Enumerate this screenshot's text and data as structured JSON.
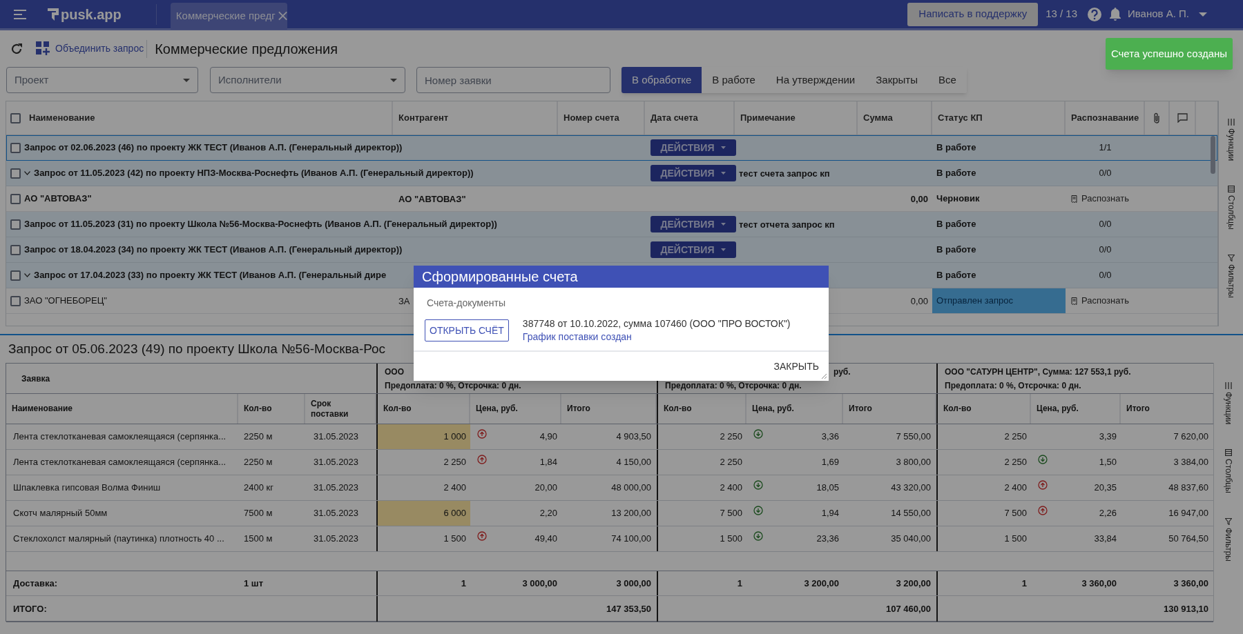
{
  "top_bar": {
    "app_name": "pusk.app",
    "tab": {
      "label": "Коммерческие предг"
    },
    "support_button": "Написать в поддержку",
    "counter": "13 / 13",
    "user": "Иванов А. П."
  },
  "toolbar": {
    "merge_link": "Объединить запрос",
    "title": "Коммерческие предложения"
  },
  "filters": [
    {
      "kind": "select",
      "placeholder": "Проект"
    },
    {
      "kind": "select",
      "placeholder": "Исполнители"
    },
    {
      "kind": "input",
      "placeholder": "Номер заявки"
    }
  ],
  "status_tabs": [
    {
      "label": "В обработке",
      "selected": true
    },
    {
      "label": "В работе",
      "selected": false
    },
    {
      "label": "На утверждении",
      "selected": false
    },
    {
      "label": "Закрыты",
      "selected": false
    },
    {
      "label": "Все",
      "selected": false
    }
  ],
  "requests_table": {
    "header_checked": false,
    "columns": [
      "Наименование",
      "Контрагент",
      "Номер счета",
      "Дата счета",
      "Примечание",
      "Сумма",
      "Статус КП",
      "Распознавание"
    ],
    "rows": [
      {
        "kind": "request",
        "checked": false,
        "selected": true,
        "expanded": false,
        "name": "Запрос от 02.06.2023 (46) по проекту ЖК ТЕСТ (Иванов А.П. (Генеральный директор))",
        "actions": "ДЕЙСТВИЯ",
        "status": "В работе",
        "recognition": "1/1"
      },
      {
        "kind": "request",
        "checked": false,
        "selected": false,
        "expanded": true,
        "name": "Запрос от 11.05.2023 (42) по проекту НПЗ-Москва-Роснефть (Иванов А.П. (Генеральный директор))",
        "actions": "ДЕЙСТВИЯ",
        "note": "тест счета запрос кп",
        "status": "В работе",
        "recognition": "0/0"
      },
      {
        "kind": "offer",
        "checked": false,
        "selected": false,
        "bold": true,
        "name": "АО \"АВТОВАЗ\"",
        "contragent": "АО \"АВТОВАЗ\"",
        "sum": "0,00",
        "status": "Черновик",
        "status_highlighted": false,
        "recognize": "Распознать"
      },
      {
        "kind": "request",
        "checked": false,
        "selected": false,
        "expanded": false,
        "name": "Запрос от 11.05.2023 (31) по проекту Школа №56-Москва-Роснефть (Иванов А.П. (Генеральный директор))",
        "actions": "ДЕЙСТВИЯ",
        "note": "тест отчета запрос кп",
        "status": "В работе",
        "recognition": "0/0"
      },
      {
        "kind": "request",
        "checked": false,
        "selected": false,
        "expanded": false,
        "name": "Запрос от 18.04.2023 (34) по проекту ЖК ТЕСТ (Иванов А.П. (Генеральный директор))",
        "actions": "ДЕЙСТВИЯ",
        "status": "В работе",
        "recognition": "0/0"
      },
      {
        "kind": "request",
        "checked": false,
        "selected": false,
        "expanded": true,
        "name": "Запрос от 17.04.2023 (33) по проекту ЖК ТЕСТ (Иванов А.П. (Генеральный дире",
        "status": "В работе",
        "recognition": "0/0"
      },
      {
        "kind": "offer",
        "checked": false,
        "selected": false,
        "bold": false,
        "name": "ЗАО \"ОГНЕБОРЕЦ\"",
        "contragent": "ЗА",
        "sum": "0,00",
        "status": "Отправлен запрос",
        "status_highlighted": true,
        "recognize": "Распознать"
      }
    ],
    "side_panel": [
      "Функции",
      "Столбцы",
      "Фильтры"
    ]
  },
  "comparison": {
    "title": "Запрос от 05.06.2023 (49) по проекту Школа №56-Москва-Рос",
    "request_header": "Заявка",
    "columns": [
      "Наименование",
      "Кол-во",
      "Срок поставки"
    ],
    "suppliers": [
      {
        "title": "ООО",
        "terms": "Предоплата: 0 %, Отсрочка: 0 дн.",
        "columns": [
          "Кол-во",
          "Цена, руб.",
          "Итого"
        ]
      },
      {
        "title": "руб.",
        "terms": "Предоплата: 0 %, Отсрочка: 0 дн.",
        "columns": [
          "Кол-во",
          "Цена, руб.",
          "Итого"
        ]
      },
      {
        "title": "ООО \"САТУРН ЦЕНТР\", Сумма: 127 553,1 руб.",
        "terms": "Предоплата: 0 %, Отсрочка: 0 дн.",
        "columns": [
          "Кол-во",
          "Цена, руб.",
          "Итого"
        ]
      }
    ],
    "rows": [
      {
        "name": "Лента стеклотканевая самоклеящаяся (серпянка...",
        "qty": "2250 м",
        "date": "31.05.2023",
        "offers": [
          {
            "qty": "1 000",
            "highlighted": true,
            "rising": true,
            "falling": false,
            "price": "4,90",
            "total": "4 903,50"
          },
          {
            "qty": "2 250",
            "highlighted": false,
            "rising": false,
            "falling": true,
            "price": "3,36",
            "total": "7 550,00"
          },
          {
            "qty": "2 250",
            "highlighted": false,
            "rising": false,
            "falling": false,
            "price": "3,39",
            "total": "7 620,00"
          }
        ]
      },
      {
        "name": "Лента стеклотканевая самоклеящаяся (серпянка...",
        "qty": "2250 м",
        "date": "31.05.2023",
        "offers": [
          {
            "qty": "2 250",
            "highlighted": false,
            "rising": true,
            "falling": false,
            "price": "1,84",
            "total": "4 150,00"
          },
          {
            "qty": "2 250",
            "highlighted": false,
            "rising": false,
            "falling": false,
            "price": "1,69",
            "total": "3 800,00"
          },
          {
            "qty": "2 250",
            "highlighted": false,
            "rising": false,
            "falling": true,
            "price": "1,50",
            "total": "3 384,00"
          }
        ]
      },
      {
        "name": "Шпаклевка гипсовая Волма Финиш",
        "qty": "2400 кг",
        "date": "31.05.2023",
        "offers": [
          {
            "qty": "2 400",
            "highlighted": false,
            "rising": false,
            "falling": false,
            "price": "20,00",
            "total": "48 000,00"
          },
          {
            "qty": "2 400",
            "highlighted": false,
            "rising": false,
            "falling": true,
            "price": "18,05",
            "total": "43 320,00"
          },
          {
            "qty": "2 400",
            "highlighted": false,
            "rising": true,
            "falling": false,
            "price": "20,35",
            "total": "48 837,60"
          }
        ]
      },
      {
        "name": "Скотч малярный 50мм",
        "qty": "7500 м",
        "date": "31.05.2023",
        "offers": [
          {
            "qty": "6 000",
            "highlighted": true,
            "rising": false,
            "falling": false,
            "price": "2,20",
            "total": "13 200,00"
          },
          {
            "qty": "7 500",
            "highlighted": false,
            "rising": false,
            "falling": true,
            "price": "1,94",
            "total": "14 550,00"
          },
          {
            "qty": "7 500",
            "highlighted": false,
            "rising": true,
            "falling": false,
            "price": "2,26",
            "total": "16 947,00"
          }
        ]
      },
      {
        "name": "Стеклохолст малярный (паутинка) плотность 40 ...",
        "qty": "1500 м",
        "date": "31.05.2023",
        "offers": [
          {
            "qty": "1 500",
            "highlighted": false,
            "rising": true,
            "falling": false,
            "price": "49,40",
            "total": "74 100,00"
          },
          {
            "qty": "1 500",
            "highlighted": false,
            "rising": false,
            "falling": true,
            "price": "23,36",
            "total": "35 040,00"
          },
          {
            "qty": "1 500",
            "highlighted": false,
            "rising": false,
            "falling": false,
            "price": "33,84",
            "total": "50 764,50"
          }
        ]
      }
    ],
    "delivery": {
      "label": "Доставка:",
      "qty": "1 шт",
      "offers": [
        {
          "qty": "1",
          "price": "3 000,00",
          "total": "3 000,00"
        },
        {
          "qty": "1",
          "price": "3 200,00",
          "total": "3 200,00"
        },
        {
          "qty": "1",
          "price": "3 360,00",
          "total": "3 360,00"
        }
      ]
    },
    "total": {
      "label": "ИТОГО:",
      "offers": [
        {
          "total": "147 353,50"
        },
        {
          "total": "107 460,00"
        },
        {
          "total": "130 913,10"
        }
      ]
    },
    "side_panel": [
      "Функции",
      "Столбцы",
      "Фильтры"
    ]
  },
  "modal": {
    "title": "Сформированные счета",
    "section": "Счета-документы",
    "open_button": "ОТКРЫТЬ СЧЁТ",
    "invoice": "387748 от 10.10.2022, сумма 107460 (ООО \"ПРО ВОСТОК\")",
    "schedule_link": "График поставки создан",
    "close_button": "ЗАКРЫТЬ"
  },
  "toast": "Счета успешно созданы"
}
